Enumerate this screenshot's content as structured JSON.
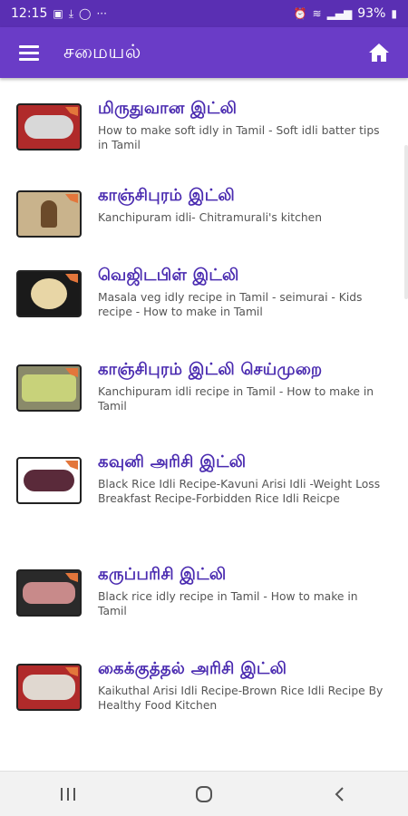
{
  "status_bar": {
    "time": "12:15",
    "battery": "93%",
    "background": "#5a2fb3"
  },
  "app_bar": {
    "title": "சமையல்",
    "background": "#6a3cc7",
    "menu_icon": "menu-icon",
    "home_icon": "home-icon"
  },
  "list": {
    "items": [
      {
        "title": "மிருதுவான இட்லி",
        "subtitle": "How to make soft idly in Tamil - Soft idli batter tips in Tamil",
        "thumb_color": "#b02a2a",
        "thumb_fg": "#d8d8d8"
      },
      {
        "title": "காஞ்சிபுரம் இட்லி",
        "subtitle": "Kanchipuram idli- Chitramurali's kitchen",
        "thumb_color": "#c9b38c",
        "thumb_fg": "#6b4a2a"
      },
      {
        "title": "வெஜிடபிள் இட்லி",
        "subtitle": "Masala veg idly recipe in Tamil - seimurai - Kids recipe - How to make in Tamil",
        "thumb_color": "#1a1a1a",
        "thumb_fg": "#e8d6a6"
      },
      {
        "title": "காஞ்சிபுரம் இட்லி செய்முறை",
        "subtitle": "Kanchipuram idli recipe in Tamil - How to make in Tamil",
        "thumb_color": "#8a8a6a",
        "thumb_fg": "#c8d27a"
      },
      {
        "title": "கவுனி அரிசி இட்லி",
        "subtitle": "Black Rice Idli Recipe-Kavuni Arisi Idli -Weight Loss Breakfast Recipe-Forbidden Rice Idli Reicpe",
        "thumb_color": "#ffffff",
        "thumb_fg": "#5a2a3a"
      },
      {
        "title": "கருப்பரிசி இட்லி",
        "subtitle": "Black rice idly recipe in Tamil - How to make in Tamil",
        "thumb_color": "#2a2a2a",
        "thumb_fg": "#c88a8a"
      },
      {
        "title": "கைக்குத்தல் அரிசி இட்லி",
        "subtitle": "Kaikuthal Arisi Idli Recipe-Brown Rice Idli Recipe By Healthy Food Kitchen",
        "thumb_color": "#b02a2a",
        "thumb_fg": "#e0d8d0"
      }
    ]
  },
  "colors": {
    "title_text": "#4a2bb0",
    "subtitle_text": "#555555"
  },
  "nav_bar": {
    "recents_icon": "recents-icon",
    "home_icon": "home-circle-icon",
    "back_icon": "back-icon"
  }
}
